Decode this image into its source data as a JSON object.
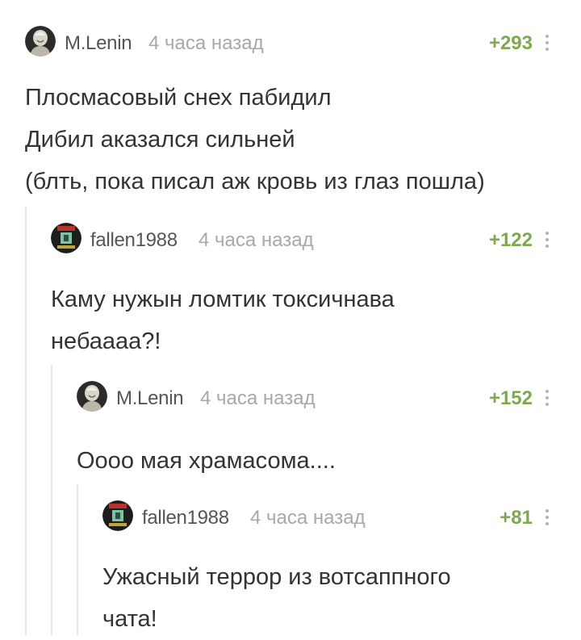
{
  "comments": [
    {
      "author": "M.Lenin",
      "time": "4 часа назад",
      "rating": "+293",
      "lines": [
        "Плосмасовый снех пабидил",
        "Дибил аказался сильней",
        "(блть, пока писал аж кровь из глаз пошла)"
      ],
      "avatar_icon": "lenin-portrait-avatar"
    },
    {
      "author": "fallen1988",
      "time": "4 часа назад",
      "rating": "+122",
      "lines": [
        "Каму нужын ломтик токсичнава",
        "небаааа?!"
      ],
      "avatar_icon": "fallout-poster-avatar"
    },
    {
      "author": "M.Lenin",
      "time": "4 часа назад",
      "rating": "+152",
      "lines": [
        "Оооо мая храмасома...."
      ],
      "avatar_icon": "lenin-portrait-avatar"
    },
    {
      "author": "fallen1988",
      "time": "4 часа назад",
      "rating": "+81",
      "lines": [
        "Ужасный террор из вотсаппного",
        "чата!"
      ],
      "avatar_icon": "fallout-poster-avatar"
    }
  ],
  "colors": {
    "rating": "#7ea852",
    "timestamp": "#a8a8a8",
    "username": "#555555",
    "text": "#333333",
    "thread_line": "#e8e8e8"
  }
}
